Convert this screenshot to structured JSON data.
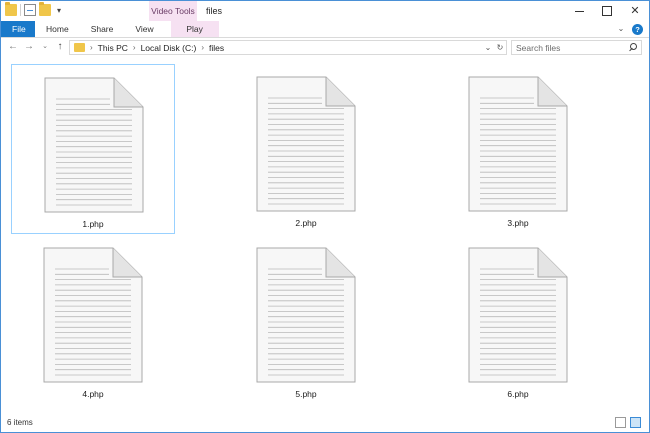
{
  "window": {
    "title": "files",
    "context_tab_title": "Video Tools"
  },
  "ribbon": {
    "tabs": [
      "File",
      "Home",
      "Share",
      "View",
      "Play"
    ]
  },
  "address": {
    "crumbs": [
      "This PC",
      "Local Disk (C:)",
      "files"
    ]
  },
  "search": {
    "placeholder": "Search files"
  },
  "files": [
    {
      "name": "1.php",
      "selected": true
    },
    {
      "name": "2.php",
      "selected": false
    },
    {
      "name": "3.php",
      "selected": false
    },
    {
      "name": "4.php",
      "selected": false
    },
    {
      "name": "5.php",
      "selected": false
    },
    {
      "name": "6.php",
      "selected": false
    }
  ],
  "status": {
    "item_count": "6 items"
  },
  "colors": {
    "accent": "#1979ca",
    "context_tab": "#f6e1f2",
    "selection_border": "#99d1ff",
    "folder": "#f0c64a"
  },
  "icons": {
    "file": "document-icon",
    "folder": "folder-icon",
    "search": "search-icon",
    "help": "help-icon"
  }
}
